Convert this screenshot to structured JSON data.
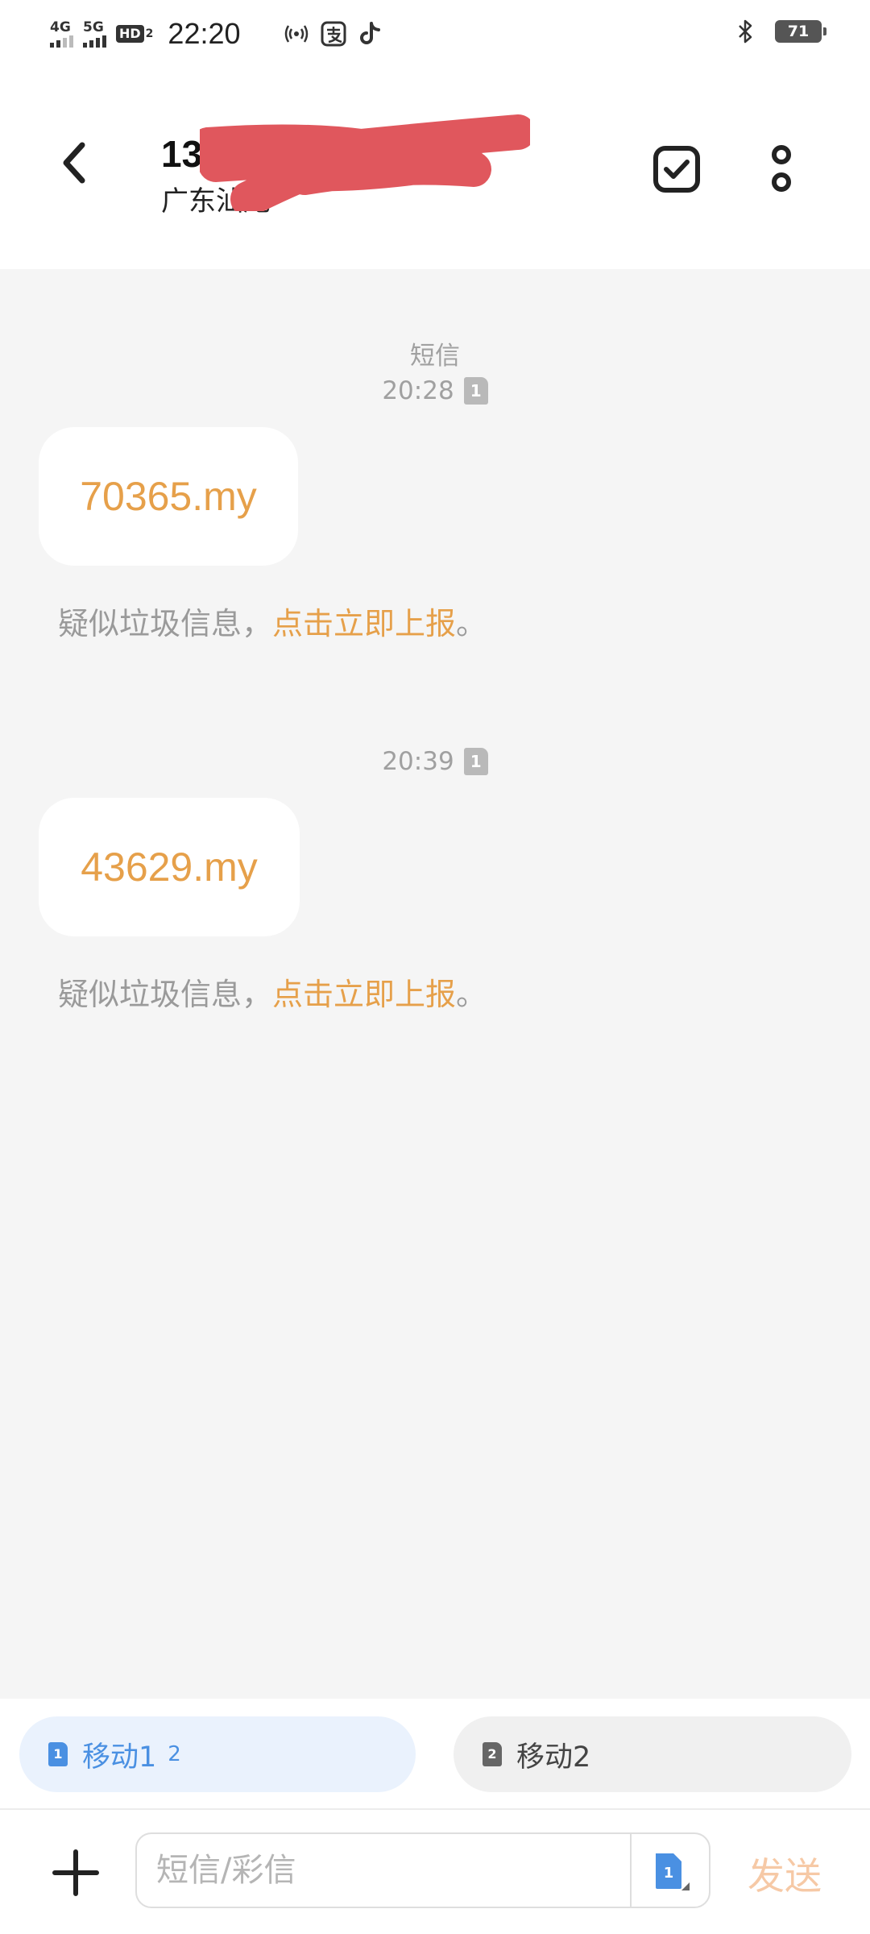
{
  "status_bar": {
    "signal1_label": "4G",
    "signal2_label": "5G",
    "hd_label": "HD",
    "hd_sub": "2",
    "time": "22:20",
    "battery": "71",
    "icons": [
      "hotspot-icon",
      "alipay-icon",
      "tiktok-icon",
      "bluetooth-icon"
    ]
  },
  "header": {
    "contact_number": "13",
    "contact_location": "广东汕尾",
    "redaction_color": "#e0575d"
  },
  "conversation": {
    "type_label": "短信",
    "messages": [
      {
        "time": "20:28",
        "sim": "1",
        "text": "70365.my",
        "spam_prefix": "疑似垃圾信息，",
        "spam_link": "点击立即上报",
        "spam_suffix": "。"
      },
      {
        "time": "20:39",
        "sim": "1",
        "text": "43629.my",
        "spam_prefix": "疑似垃圾信息，",
        "spam_link": "点击立即上报",
        "spam_suffix": "。"
      }
    ]
  },
  "sim_selector": {
    "sim1": {
      "icon": "1",
      "label": "移动1",
      "sub": "2"
    },
    "sim2": {
      "icon": "2",
      "label": "移动2"
    }
  },
  "composer": {
    "placeholder": "短信/彩信",
    "value": "",
    "sim_icon": "1",
    "send_label": "发送"
  },
  "colors": {
    "accent": "#e6a04a",
    "sim_blue": "#4a90e2",
    "send_disabled": "#f6c9a6",
    "background": "#f5f5f5"
  }
}
